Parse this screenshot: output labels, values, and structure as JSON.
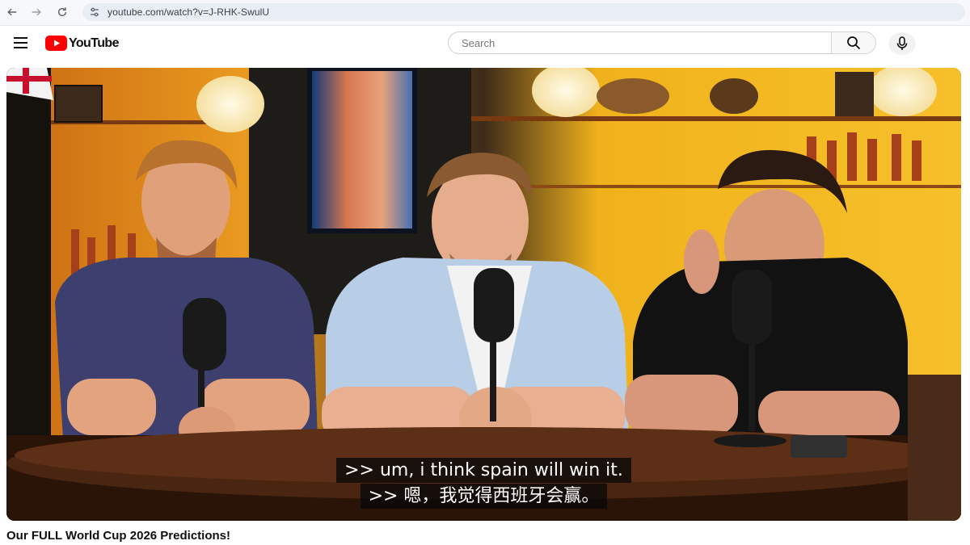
{
  "browser": {
    "url": "youtube.com/watch?v=J-RHK-SwulU",
    "back_icon": "arrow-left-icon",
    "forward_icon": "arrow-right-icon",
    "reload_icon": "reload-icon"
  },
  "header": {
    "logo_text": "YouTube",
    "search_placeholder": "Search",
    "brand_color": "#ff0000"
  },
  "video": {
    "captions": [
      ">> um, i think spain will win it.",
      ">> 嗯，我觉得西班牙会赢。"
    ]
  },
  "title": "Our FULL World Cup 2026 Predictions!"
}
